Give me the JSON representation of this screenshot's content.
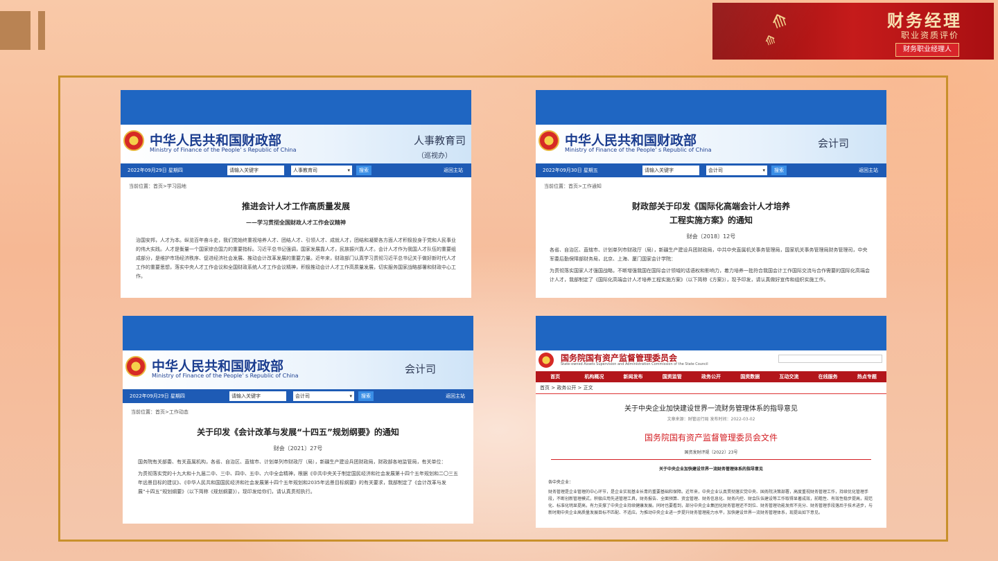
{
  "badge": {
    "title": "财务经理",
    "subtitle": "职业资质评价",
    "tag": "财务职业经理人"
  },
  "mof": {
    "cn_name": "中华人民共和国财政部",
    "en_name": "Ministry of Finance of the People' s Republic of China",
    "search_placeholder": "请输入关键字",
    "search_button": "搜索",
    "home_link": "返回主站"
  },
  "cards": [
    {
      "dept": "人事教育司",
      "dept_sub": "（巡视办）",
      "date": "2022年09月29日  星期四",
      "select": "人事教育司",
      "crumb": "当前位置：首页>学习园地",
      "title": "推进会计人才工作高质量发展",
      "subtitle": "——学习贯彻全国财政人才工作会议精神",
      "body": "治国安邦，人才为本。纵览百年奋斗史，我们党始终重视培养人才、团结人才、引领人才、成就人才，团结和凝聚各方面人才积极投身于党和人民事业的伟大实践。人才是衡量一个国家综合国力的重要指标。习近平总书记强调，国家发展靠人才，民族振兴靠人才。会计人才作为我国人才队伍的重要组成部分，是维护市场经济秩序、促进经济社会发展、推动会计改革发展的重要力量。近年来，财政部门认真学习贯彻习近平总书记关于做好新时代人才工作的重要思想，落实中央人才工作会议和全国财政系统人才工作会议精神，积极推动会计人才工作高质量发展，切实服务国家战略部署和财政中心工作。"
    },
    {
      "dept": "会计司",
      "date": "2022年09月30日  星期五",
      "select": "会计司",
      "crumb": "当前位置：首页>工作通知",
      "title_line1": "财政部关于印发《国际化高端会计人才培养",
      "title_line2": "工程实施方案》的通知",
      "docno": "财会〔2018〕12号",
      "body1": "各省、自治区、直辖市、计划单列市财政厅（局），新疆生产建设兵团财政局，中共中央直属机关事务管理局，国家机关事务管理局财务管理司，中央军委后勤保障部财务局，北京、上海、厦门国家会计学院：",
      "body2": "为贯彻落实国家人才强国战略，不断增强我国在国际会计领域的话语权和影响力，着力培养一批符合我国会计工作国际交流与合作需要的国际化高端会计人才，我部制定了《国际化高端会计人才培养工程实施方案》（以下简称《方案》），现予印发，请认真做好宣传和组织实施工作。"
    },
    {
      "dept": "会计司",
      "date": "2022年09月29日  星期四",
      "select": "会计司",
      "crumb": "当前位置：首页>工作动态",
      "title": "关于印发《会计改革与发展“十四五”规划纲要》的通知",
      "docno": "财会〔2021〕27号",
      "body1": "国务院有关部委、有关直属机构，各省、自治区、直辖市、计划单列市财政厅（局），新疆生产建设兵团财政局，财政部各地监管局，有关单位：",
      "body2": "为贯彻落实党的十九大和十九届二中、三中、四中、五中、六中全会精神，根据《中共中央关于制定国民经济和社会发展第十四个五年规划和二〇三五年远景目标的建议》、《中华人民共和国国民经济和社会发展第十四个五年规划和2035年远景目标纲要》的有关要求，我部制定了《会计改革与发展“十四五”规划纲要》（以下简称《规划纲要》），现印发给你们，请认真贯彻执行。"
    }
  ],
  "sasac": {
    "cn_name": "国务院国有资产监督管理委员会",
    "en_name": "State-owned Assets Supervision and Administration Commission of the State Council",
    "nav": [
      "首页",
      "机构概况",
      "新闻发布",
      "国资监管",
      "政务公开",
      "国资数据",
      "互动交流",
      "在线服务",
      "热点专题"
    ],
    "crumb": "首页  >  政务公开  >  正文",
    "title": "关于中央企业加快建设世界一流财务管理体系的指导意见",
    "meta": "文章来源：财管运行局     发布时间：2022-03-02",
    "file_header": "国务院国有资产监督管理委员会文件",
    "docno": "国资发财评规〔2022〕23号",
    "head2": "关于中央企业加快建设世界一流财务管理体系的指导意见",
    "to": "各中央企业：",
    "body": "财务管理是企业管理的中心环节，是企业实现基业长青的重要基础和保障。近年来，中央企业认真贯彻落实党中央、国务院决策部署，高度重视财务管理工作，持续优化管理手段，不断创新管理模式，积极应用先进管理工具，财务报告、全面预算、资金管理、财务信息化、财务内控、财会队伍建设等工作取得显著成效，前瞻性、有效性稳步提高，规范化、标准化明显提高，有力支撑了中央企业持续健康发展。同时也要看到，部分中央企业集团化财务管理还不到位、财务管理功能发挥不充分、财务管理手段落后于技术进步，与新时期中央企业高质量发展目标不匹配、不适应。为推动中央企业进一步提升财务管理能力水平，加快建设世界一流财务管理体系，现提出如下意见。"
  }
}
